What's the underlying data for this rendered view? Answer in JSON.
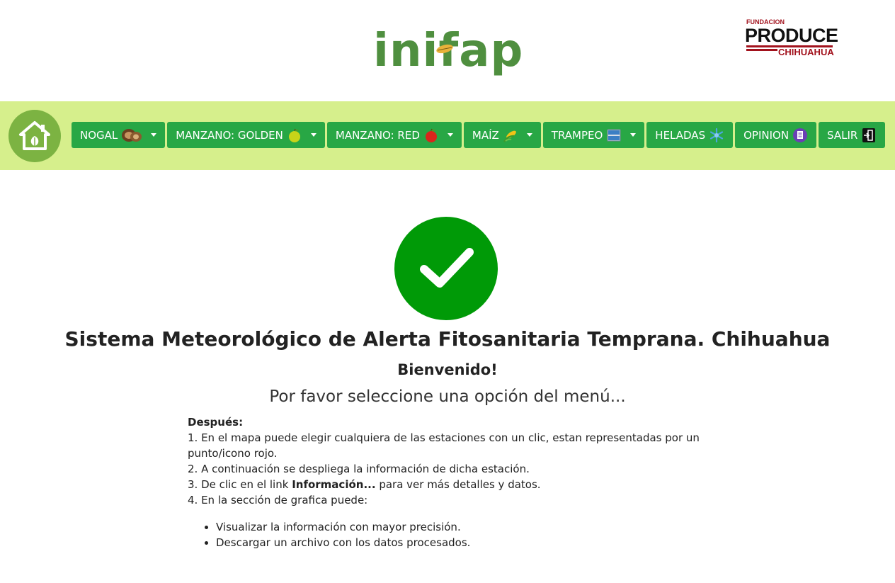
{
  "header": {
    "inifap_logo_text": "inifap",
    "produce_logo": {
      "top": "FUNDACION",
      "main": "PRODUCE",
      "bottom": "CHIHUAHUA"
    }
  },
  "nav": {
    "home_icon": "house-leaf-icon",
    "items": [
      {
        "label": "NOGAL",
        "icon": "walnut-icon",
        "dropdown": true
      },
      {
        "label": "MANZANO: GOLDEN",
        "icon": "yellow-apple-icon",
        "dropdown": true
      },
      {
        "label": "MANZANO: RED",
        "icon": "red-apple-icon",
        "dropdown": true
      },
      {
        "label": "MAÍZ",
        "icon": "corn-icon",
        "dropdown": true
      },
      {
        "label": "TRAMPEO",
        "icon": "trap-icon",
        "dropdown": true
      },
      {
        "label": "HELADAS",
        "icon": "snowflake-icon",
        "dropdown": false
      },
      {
        "label": "OPINION",
        "icon": "document-icon",
        "dropdown": false
      },
      {
        "label": "SALIR",
        "icon": "logout-icon",
        "dropdown": false
      }
    ]
  },
  "main": {
    "status_icon": "check-circle-icon",
    "title": "Sistema Meteorológico de Alerta Fitosanitaria Temprana. Chihuahua",
    "welcome": "Bienvenido!",
    "subtitle": "Por favor seleccione una opción del menú...",
    "instructions": {
      "heading": "Después:",
      "step1": "1. En el mapa puede elegir cualquiera de las estaciones con un clic, estan representadas por un punto/icono rojo.",
      "step2": "2. A continuación se despliega la información de dicha estación.",
      "step3_pre": "3. De clic en el link ",
      "step3_bold": "Información...",
      "step3_post": " para ver más detalles y datos.",
      "step4": "4. En la sección de grafica puede:",
      "bullets": [
        "Visualizar la información con mayor precisión.",
        "Descargar un archivo con los datos procesados."
      ]
    }
  },
  "colors": {
    "navbar_bg": "#d6ef8c",
    "button_green": "#28a745",
    "check_green": "#009a07",
    "home_circle": "#7cb342",
    "produce_red": "#a2121d"
  }
}
